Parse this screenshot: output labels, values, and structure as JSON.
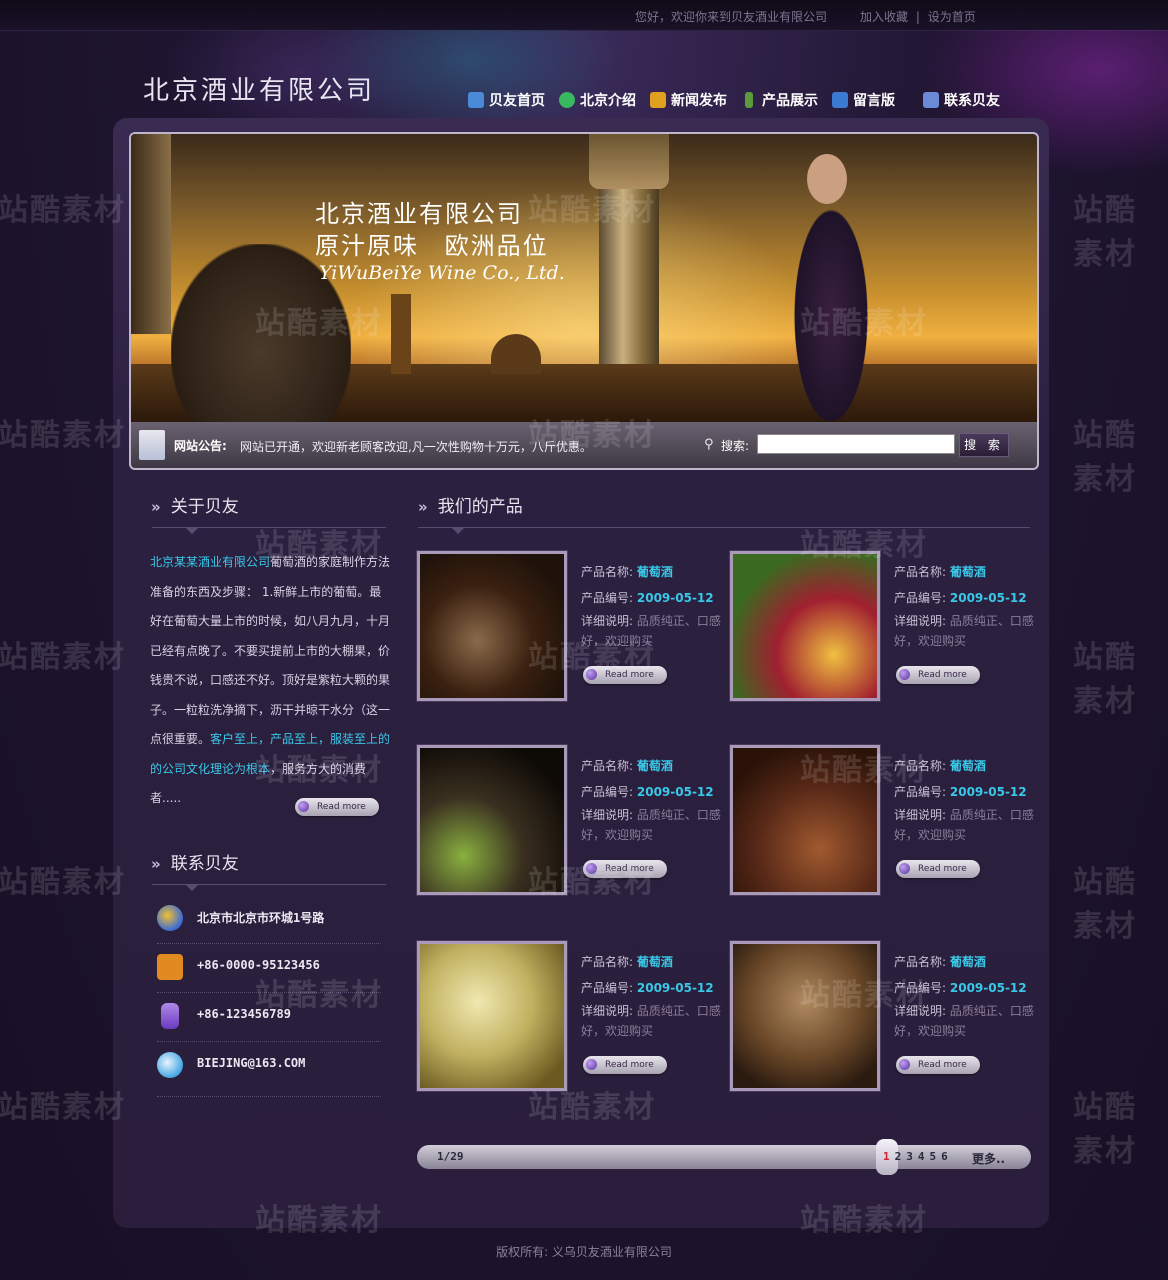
{
  "top": {
    "welcome": "您好，欢迎你来到贝友酒业有限公司",
    "bookmark": "加入收藏",
    "separator": "|",
    "homepage": "设为首页"
  },
  "logo": "北京酒业有限公司",
  "nav": [
    {
      "label": "贝友首页",
      "icon": "home-icon",
      "color": "#4a8ad8"
    },
    {
      "label": "北京介绍",
      "icon": "flower-icon",
      "color": "#3ab860"
    },
    {
      "label": "新闻发布",
      "icon": "box-icon",
      "color": "#e0a020"
    },
    {
      "label": "产品展示",
      "icon": "bottle-icon",
      "color": "#5a9a3a"
    },
    {
      "label": "留言版",
      "icon": "notepad-icon",
      "color": "#3a7ad0"
    },
    {
      "label": "联系贝友",
      "icon": "phone-icon",
      "color": "#6a8ad8"
    }
  ],
  "banner": {
    "title": "北京酒业有限公司",
    "slogan": "原汁原味 欧洲品位",
    "english": "YiWuBeiYe Wine Co., Ltd."
  },
  "notice": {
    "label": "网站公告:",
    "text": "网站已开通，欢迎新老顾客改迎,凡一次性购物十万元，八斤优惠。",
    "search_label": "搜索:",
    "search_value": "",
    "search_button": "搜 索"
  },
  "about": {
    "heading": "关于贝友",
    "company": "北京某某酒业有限公司",
    "text1": "葡萄酒的家庭制作方法准备的东西及步骤：  1.新鲜上市的葡萄。最好在葡萄大量上市的时候，如八月九月，十月已经有点晚了。不要买提前上市的大棚果，价钱贵不说，口感还不好。顶好是紫粒大颗的果子。一粒粒洗净摘下，沥干并晾干水分（这一点很重要。",
    "highlight": "客户至上，产品至上，服装至上的的公司文化理论为根本",
    "text2": "，服务方大的消费者.....",
    "readmore": "Read more"
  },
  "contact": {
    "heading": "联系贝友",
    "rows": [
      {
        "icon": "globe-icon",
        "text": "北京市北京市环城1号路",
        "color": "#3a6ad8"
      },
      {
        "icon": "users-icon",
        "text": "+86-0000-95123456",
        "color": "#e08a20"
      },
      {
        "icon": "mobile-icon",
        "text": "+86-123456789",
        "color": "#8a5ad8"
      },
      {
        "icon": "mail-icon",
        "text": "BIEJING@163.COM",
        "color": "#3aa0e0"
      }
    ]
  },
  "products": {
    "heading": "我们的产品",
    "name_label": "产品名称:",
    "code_label": "产品编号:",
    "desc_label": "详细说明:",
    "readmore": "Read more",
    "items": [
      {
        "name": "葡萄酒",
        "code": "2009-05-12",
        "desc": "品质纯正、口感好，欢迎购买"
      },
      {
        "name": "葡萄酒",
        "code": "2009-05-12",
        "desc": "品质纯正、口感好，欢迎购买"
      },
      {
        "name": "葡萄酒",
        "code": "2009-05-12",
        "desc": "品质纯正、口感好，欢迎购买"
      },
      {
        "name": "葡萄酒",
        "code": "2009-05-12",
        "desc": "品质纯正、口感好，欢迎购买"
      },
      {
        "name": "葡萄酒",
        "code": "2009-05-12",
        "desc": "品质纯正、口感好，欢迎购买"
      },
      {
        "name": "葡萄酒",
        "code": "2009-05-12",
        "desc": "品质纯正、口感好，欢迎购买"
      }
    ]
  },
  "pager": {
    "count": "1/29",
    "pages": [
      "1",
      "2",
      "3",
      "4",
      "5",
      "6"
    ],
    "current": "1",
    "more": "更多.."
  },
  "footer": "版权所有: 义乌贝友酒业有限公司",
  "watermark": "站酷素材"
}
